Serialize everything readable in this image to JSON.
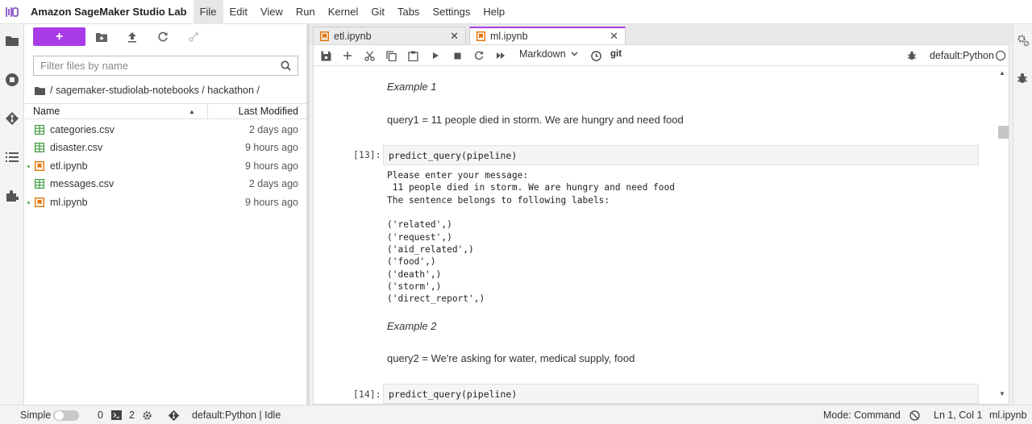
{
  "app": {
    "title": "Amazon SageMaker Studio Lab"
  },
  "menu": [
    "File",
    "Edit",
    "View",
    "Run",
    "Kernel",
    "Git",
    "Tabs",
    "Settings",
    "Help"
  ],
  "filebrowser": {
    "new_label": "+",
    "filter_placeholder": "Filter files by name",
    "breadcrumb": "/ sagemaker-studiolab-notebooks / hackathon /",
    "col_name": "Name",
    "col_modified": "Last Modified",
    "files": [
      {
        "name": "categories.csv",
        "modified": "2 days ago",
        "type": "csv",
        "running": false
      },
      {
        "name": "disaster.csv",
        "modified": "9 hours ago",
        "type": "csv",
        "running": false
      },
      {
        "name": "etl.ipynb",
        "modified": "9 hours ago",
        "type": "notebook",
        "running": true
      },
      {
        "name": "messages.csv",
        "modified": "2 days ago",
        "type": "csv",
        "running": false
      },
      {
        "name": "ml.ipynb",
        "modified": "9 hours ago",
        "type": "notebook",
        "running": true
      }
    ]
  },
  "tabs": [
    {
      "label": "etl.ipynb",
      "active": false
    },
    {
      "label": "ml.ipynb",
      "active": true
    }
  ],
  "toolbar": {
    "cell_type": "Markdown",
    "git_label": "git",
    "kernel": "default:Python"
  },
  "notebook": {
    "example1": "Example 1",
    "query1": "query1 = 11 people died in storm. We are hungry and need food",
    "prompt13": "[13]:",
    "code13": "predict_query(pipeline)",
    "output": [
      "Please enter your message:",
      " 11 people died in storm. We are hungry and need food",
      "The sentence belongs to following labels:",
      "",
      "('related',)",
      "('request',)",
      "('aid_related',)",
      "('food',)",
      "('death',)",
      "('storm',)",
      "('direct_report',)"
    ],
    "example2": "Example 2",
    "query2": "query2 = We're asking for water, medical supply, food",
    "prompt14": "[14]:",
    "code14": "predict_query(pipeline)"
  },
  "statusbar": {
    "simple": "Simple",
    "terminals": "0",
    "kernels": "2",
    "kernel_status": "default:Python | Idle",
    "mode": "Mode: Command",
    "position": "Ln 1, Col 1",
    "file": "ml.ipynb"
  },
  "colors": {
    "accent": "#a93ce6",
    "csv_icon": "#3c9a3c",
    "notebook_icon": "#e57200"
  }
}
